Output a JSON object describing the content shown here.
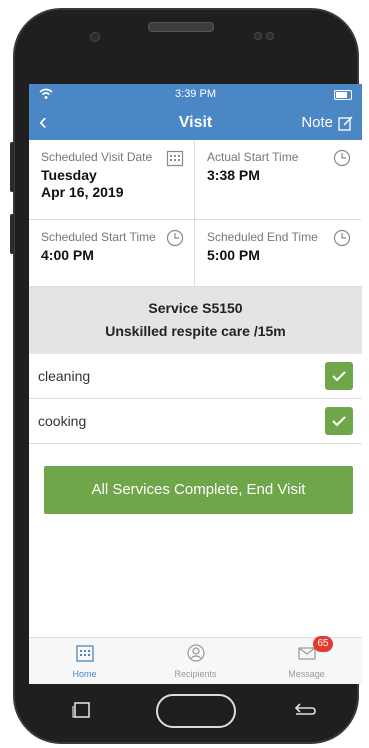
{
  "status_bar": {
    "time": "3:39 PM"
  },
  "nav": {
    "title": "Visit",
    "note_label": "Note"
  },
  "visit": {
    "scheduled_visit_date": {
      "label": "Scheduled Visit Date",
      "line1": "Tuesday",
      "line2": "Apr 16, 2019"
    },
    "actual_start": {
      "label": "Actual Start Time",
      "value": "3:38 PM"
    },
    "scheduled_start": {
      "label": "Scheduled Start Time",
      "value": "4:00 PM"
    },
    "scheduled_end": {
      "label": "Scheduled End Time",
      "value": "5:00 PM"
    }
  },
  "service": {
    "code": "Service S5150",
    "description": "Unskilled respite care /15m"
  },
  "tasks": [
    {
      "name": "cleaning",
      "checked": true
    },
    {
      "name": "cooking",
      "checked": true
    }
  ],
  "end_button": "All Services Complete, End Visit",
  "tabs": [
    {
      "label": "Home",
      "icon": "calendar-icon",
      "active": true
    },
    {
      "label": "Recipients",
      "icon": "person-icon",
      "active": false
    },
    {
      "label": "Message",
      "icon": "envelope-icon",
      "active": false,
      "badge": "65"
    }
  ],
  "colors": {
    "header": "#4b86c5",
    "accent_green": "#6fa64a",
    "badge_red": "#e53a2f"
  }
}
